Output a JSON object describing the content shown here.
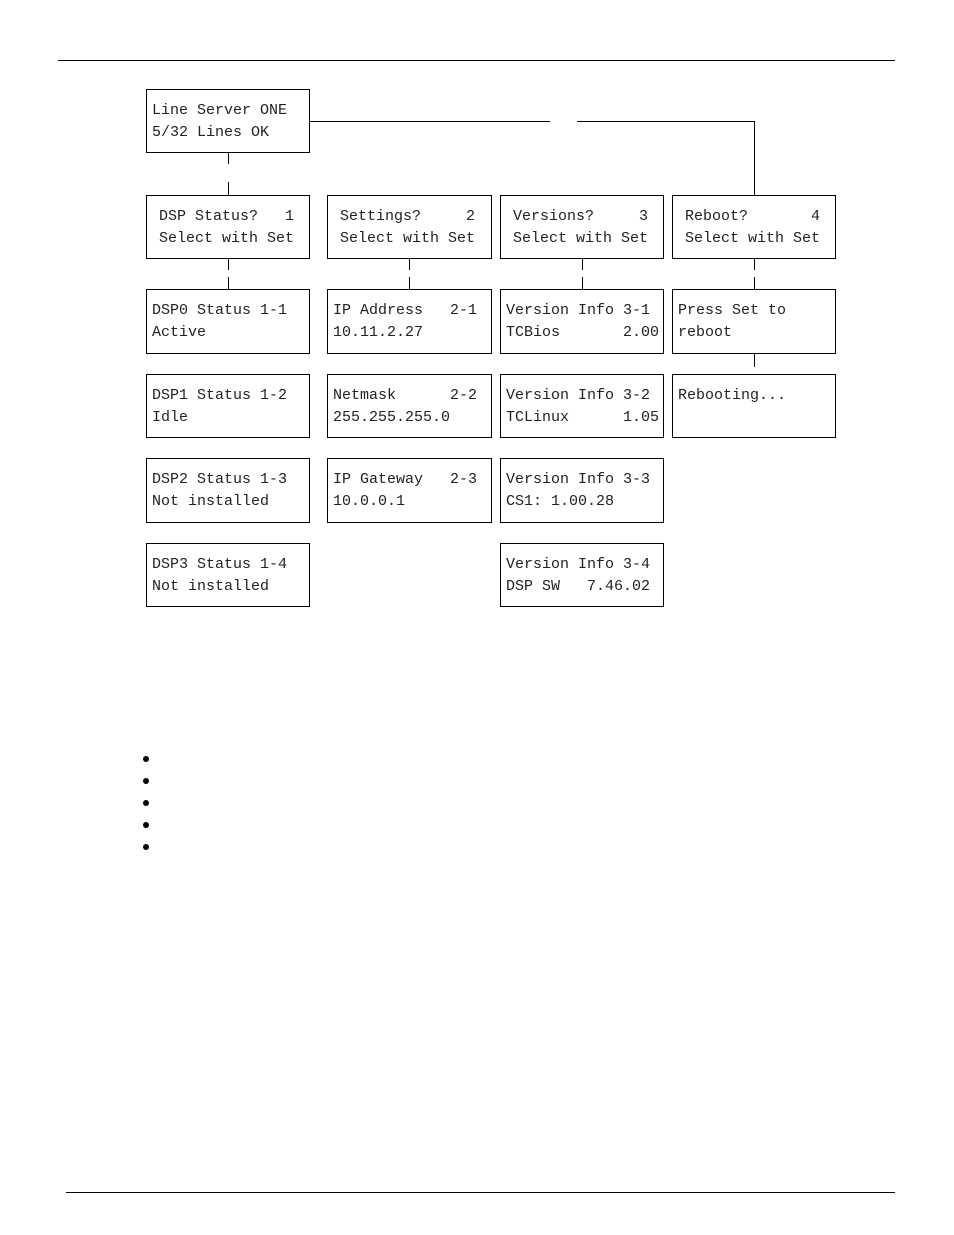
{
  "diagram": {
    "root": {
      "line1": "Line Server ONE",
      "line2": "5/32 Lines OK"
    },
    "menus": [
      {
        "line1": "DSP Status?   1",
        "line2": "Select with Set",
        "items": [
          {
            "line1": "DSP0 Status 1-1",
            "line2": "Active"
          },
          {
            "line1": "DSP1 Status 1-2",
            "line2": "Idle"
          },
          {
            "line1": "DSP2 Status 1-3",
            "line2": "Not installed"
          },
          {
            "line1": "DSP3 Status 1-4",
            "line2": "Not installed"
          }
        ]
      },
      {
        "line1": "Settings?     2",
        "line2": "Select with Set",
        "items": [
          {
            "line1": "IP Address   2-1",
            "line2": "10.11.2.27"
          },
          {
            "line1": "Netmask      2-2",
            "line2": "255.255.255.0"
          },
          {
            "line1": "IP Gateway   2-3",
            "line2": "10.0.0.1"
          }
        ]
      },
      {
        "line1": "Versions?     3",
        "line2": "Select with Set",
        "items": [
          {
            "line1": "Version Info 3-1",
            "line2": "TCBios       2.00"
          },
          {
            "line1": "Version Info 3-2",
            "line2": "TCLinux      1.05"
          },
          {
            "line1": "Version Info 3-3",
            "line2": "CS1: 1.00.28"
          },
          {
            "line1": "Version Info 3-4",
            "line2": "DSP SW   7.46.02"
          }
        ]
      },
      {
        "line1": "Reboot?       4",
        "line2": "Select with Set",
        "items": [
          {
            "line1": "Press Set to",
            "line2": "reboot"
          },
          {
            "line1": "Rebooting...",
            "line2": ""
          }
        ]
      }
    ]
  },
  "bullets": [
    "",
    "",
    "",
    "",
    ""
  ]
}
